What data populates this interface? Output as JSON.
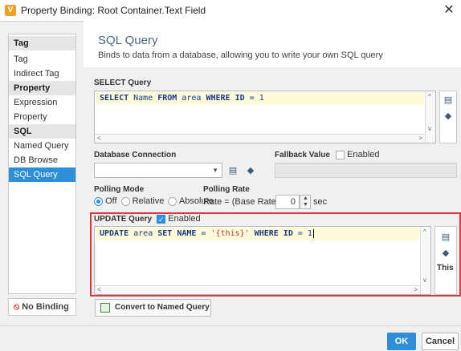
{
  "window": {
    "title": "Property Binding: Root Container.Text Field",
    "app_icon": "V",
    "close_glyph": "✕"
  },
  "sidebar": {
    "groups": [
      {
        "header": "Tag",
        "items": [
          "Tag",
          "Indirect Tag"
        ]
      },
      {
        "header": "Property",
        "items": [
          "Expression",
          "Property"
        ]
      },
      {
        "header": "SQL",
        "items": [
          "Named Query",
          "DB Browse",
          "SQL Query"
        ]
      }
    ],
    "selected": "SQL Query",
    "no_binding_label": "No Binding",
    "no_binding_icon": "⦸"
  },
  "header": {
    "title": "SQL Query",
    "description": "Binds to data from a database, allowing you to write your own SQL query"
  },
  "select_query": {
    "label": "SELECT Query",
    "code": [
      {
        "t": "SELECT",
        "c": "kw"
      },
      {
        "t": " Name ",
        "c": "id"
      },
      {
        "t": "FROM",
        "c": "kw"
      },
      {
        "t": " area ",
        "c": "id"
      },
      {
        "t": "WHERE",
        "c": "kw"
      },
      {
        "t": " ID ",
        "c": "kw"
      },
      {
        "t": "= 1",
        "c": "op"
      }
    ]
  },
  "database_connection": {
    "label": "Database Connection",
    "value": ""
  },
  "fallback": {
    "label": "Fallback Value",
    "enabled_label": "Enabled",
    "enabled": false,
    "value": ""
  },
  "polling": {
    "mode_label": "Polling Mode",
    "options": [
      "Off",
      "Relative",
      "Absolute"
    ],
    "selected": "Off",
    "rate_label": "Polling Rate",
    "rate_prefix": "Rate = (Base Rate) +/-",
    "rate_value": "0",
    "rate_unit": "sec"
  },
  "update_query": {
    "label": "UPDATE Query",
    "enabled_label": "Enabled",
    "enabled": true,
    "code": [
      {
        "t": "UPDATE",
        "c": "kw"
      },
      {
        "t": " area ",
        "c": "id"
      },
      {
        "t": "SET",
        "c": "kw"
      },
      {
        "t": " NAME ",
        "c": "kw"
      },
      {
        "t": "= ",
        "c": "op"
      },
      {
        "t": "'{this}'",
        "c": "str"
      },
      {
        "t": " WHERE",
        "c": "kw"
      },
      {
        "t": " ID ",
        "c": "kw"
      },
      {
        "t": "= 1",
        "c": "op"
      }
    ],
    "this_label": "This"
  },
  "buttons": {
    "convert": "Convert to Named Query",
    "ok": "OK",
    "cancel": "Cancel"
  },
  "icons": {
    "table_browse": "table-icon",
    "tag": "tag-icon",
    "accent": "#2e8fd8",
    "highlight": "#e0353f"
  }
}
